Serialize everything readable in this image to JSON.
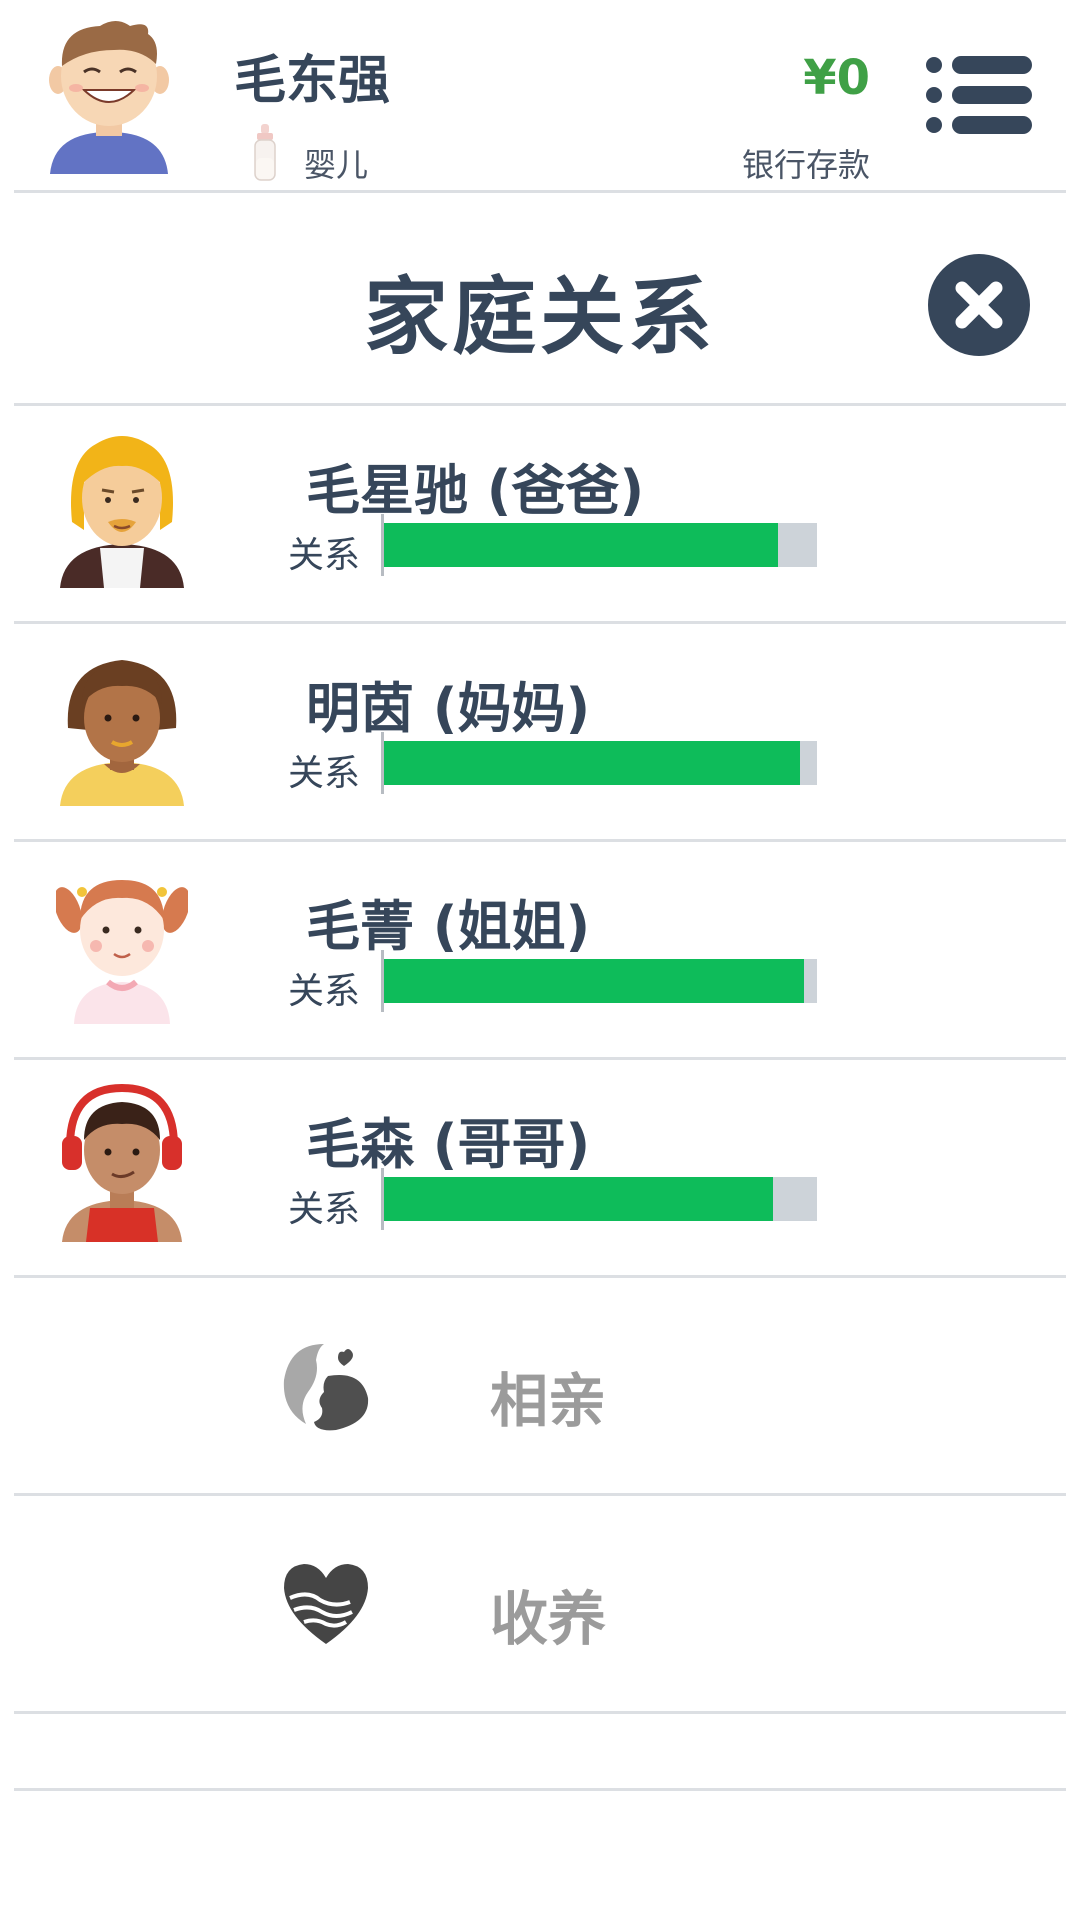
{
  "header": {
    "player_name": "毛东强",
    "life_stage": "婴儿",
    "money": "¥0",
    "bank_label": "银行存款"
  },
  "dialog": {
    "title": "家庭关系"
  },
  "family": [
    {
      "name": "毛星驰 (爸爸)",
      "relationship_label": "关系",
      "relationship_level": 0.91
    },
    {
      "name": "明茵 (妈妈)",
      "relationship_label": "关系",
      "relationship_level": 0.96
    },
    {
      "name": "毛菁 (姐姐)",
      "relationship_label": "关系",
      "relationship_level": 0.97
    },
    {
      "name": "毛森 (哥哥)",
      "relationship_label": "关系",
      "relationship_level": 0.9
    }
  ],
  "actions": [
    {
      "label": "相亲",
      "icon": "matchmaking-icon"
    },
    {
      "label": "收养",
      "icon": "adoption-heart-icon"
    }
  ],
  "colors": {
    "primary_text": "#36465a",
    "money_green": "#3fa046",
    "bar_fill": "#0ebc5a",
    "bar_track": "#cdd3d9",
    "action_gray": "#9b9b9b"
  }
}
